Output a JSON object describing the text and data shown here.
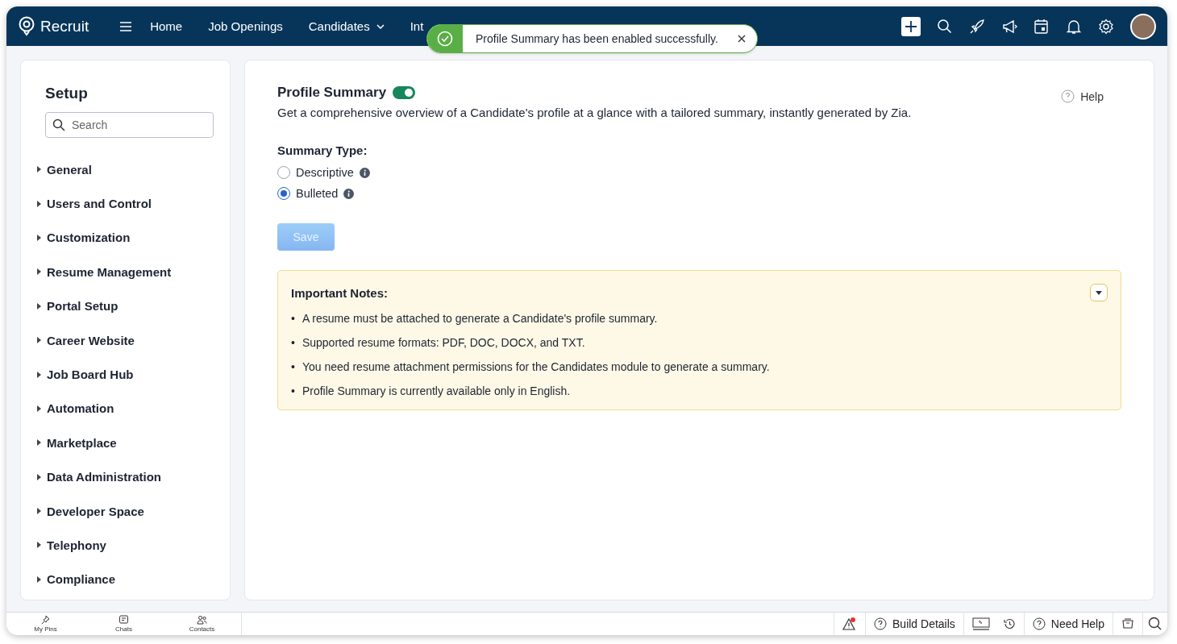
{
  "app": {
    "name": "Recruit"
  },
  "nav": [
    {
      "label": "Home",
      "dropdown": false
    },
    {
      "label": "Job Openings",
      "dropdown": false
    },
    {
      "label": "Candidates",
      "dropdown": true
    },
    {
      "label": "Int",
      "dropdown": false
    }
  ],
  "toast": {
    "message": "Profile Summary has been enabled successfully."
  },
  "sidebar": {
    "title": "Setup",
    "search": {
      "placeholder": "Search"
    },
    "items": [
      {
        "label": "General",
        "expanded": false
      },
      {
        "label": "Users and Control",
        "expanded": false
      },
      {
        "label": "Customization",
        "expanded": false
      },
      {
        "label": "Resume Management",
        "expanded": false
      },
      {
        "label": "Portal Setup",
        "expanded": false
      },
      {
        "label": "Career Website",
        "expanded": false
      },
      {
        "label": "Job Board Hub",
        "expanded": false
      },
      {
        "label": "Automation",
        "expanded": false
      },
      {
        "label": "Marketplace",
        "expanded": false
      },
      {
        "label": "Data Administration",
        "expanded": false
      },
      {
        "label": "Developer Space",
        "expanded": false
      },
      {
        "label": "Telephony",
        "expanded": false
      },
      {
        "label": "Compliance",
        "expanded": false
      }
    ]
  },
  "panel": {
    "title": "Profile Summary",
    "enabled": true,
    "description": "Get a comprehensive overview of a Candidate's profile at a glance with a tailored summary, instantly generated by Zia.",
    "help": "Help",
    "summary_type": {
      "label": "Summary Type:",
      "options": [
        {
          "label": "Descriptive",
          "selected": false
        },
        {
          "label": "Bulleted",
          "selected": true
        }
      ]
    },
    "save": {
      "label": "Save",
      "disabled": true
    },
    "notes": {
      "title": "Important Notes:",
      "expanded": true,
      "bullet": "•",
      "items": [
        "A resume must be attached to generate a Candidate's profile summary.",
        "Supported resume formats: PDF, DOC, DOCX, and TXT.",
        "You need resume attachment permissions for the Candidates module to generate a summary.",
        "Profile Summary is currently available only in English."
      ]
    }
  },
  "bottom_bar": {
    "tabs": [
      {
        "label": "My Pins",
        "kind": "pins"
      },
      {
        "label": "Chats",
        "kind": "chats"
      },
      {
        "label": "Contacts",
        "kind": "contacts"
      }
    ],
    "build_details": "Build Details",
    "need_help": "Need Help"
  }
}
